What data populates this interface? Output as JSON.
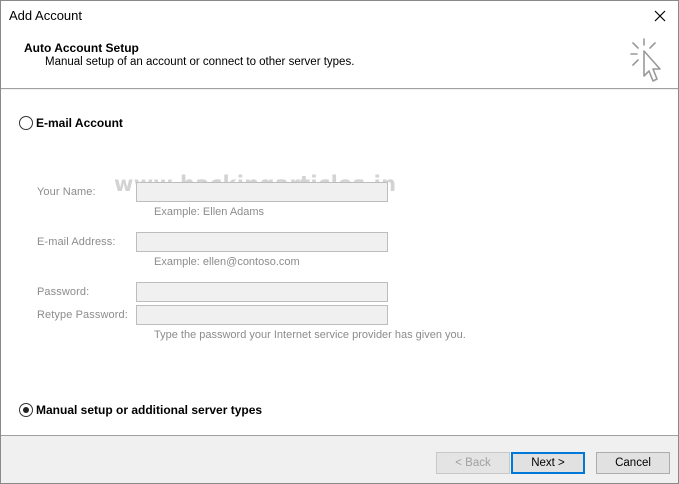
{
  "window": {
    "title": "Add Account"
  },
  "header": {
    "title": "Auto Account Setup",
    "subtitle": "Manual setup of an account or connect to other server types.",
    "icon": "cursor-click-icon"
  },
  "options": {
    "email_account": {
      "label": "E-mail Account",
      "selected": false
    },
    "manual_setup": {
      "label": "Manual setup or additional server types",
      "selected": true
    }
  },
  "watermark": "www.hackingarticles.in",
  "fields": {
    "your_name": {
      "label": "Your Name:",
      "value": "",
      "hint": "Example: Ellen Adams"
    },
    "email_address": {
      "label": "E-mail Address:",
      "value": "",
      "hint": "Example: ellen@contoso.com"
    },
    "password": {
      "label": "Password:",
      "value": ""
    },
    "retype_password": {
      "label": "Retype Password:",
      "value": ""
    },
    "password_hint": "Type the password your Internet service provider has given you."
  },
  "buttons": {
    "back": "< Back",
    "next": "Next >",
    "cancel": "Cancel"
  },
  "colors": {
    "default_button_border": "#0078d7",
    "disabled_text": "#8c8c8c"
  }
}
